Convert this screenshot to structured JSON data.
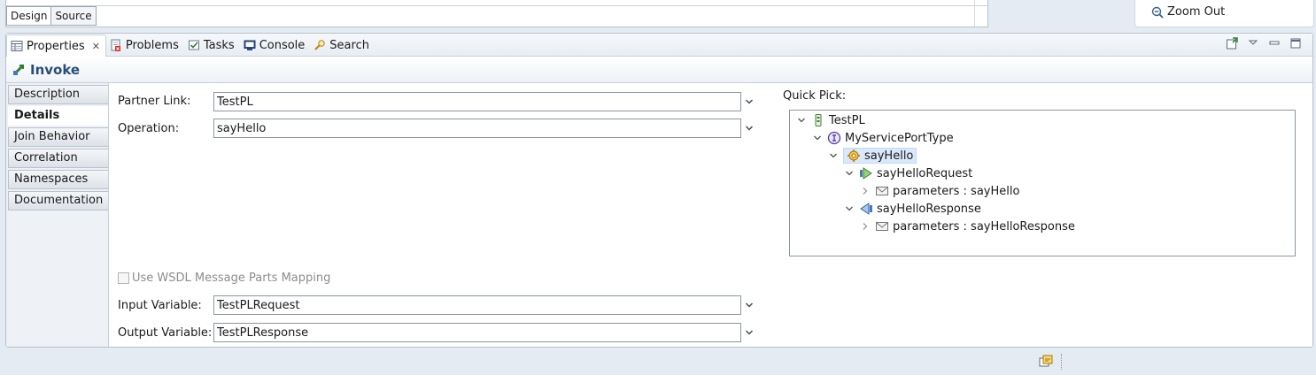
{
  "editor": {
    "tabs": [
      {
        "label": "Design",
        "active": true
      },
      {
        "label": "Source",
        "active": false
      }
    ]
  },
  "palette": {
    "zoom_out_label": "Zoom Out"
  },
  "views": {
    "tabs": [
      {
        "label": "Properties",
        "icon": "properties-icon",
        "active": true
      },
      {
        "label": "Problems",
        "icon": "problems-icon"
      },
      {
        "label": "Tasks",
        "icon": "tasks-icon"
      },
      {
        "label": "Console",
        "icon": "console-icon"
      },
      {
        "label": "Search",
        "icon": "search-icon"
      }
    ]
  },
  "properties": {
    "title": "Invoke",
    "side_tabs": [
      {
        "label": "Description",
        "active": false
      },
      {
        "label": "Details",
        "active": true
      },
      {
        "label": "Join Behavior",
        "active": false
      },
      {
        "label": "Correlation",
        "active": false
      },
      {
        "label": "Namespaces",
        "active": false
      },
      {
        "label": "Documentation",
        "active": false
      }
    ],
    "partner_link": {
      "label": "Partner Link:",
      "value": "TestPL"
    },
    "operation": {
      "label": "Operation:",
      "value": "sayHello"
    },
    "wsdl_mapping": {
      "label": "Use WSDL Message Parts Mapping",
      "checked": false,
      "enabled": false
    },
    "input_variable": {
      "label": "Input Variable:",
      "value": "TestPLRequest"
    },
    "output_variable": {
      "label": "Output Variable:",
      "value": "TestPLResponse"
    },
    "quick_pick": {
      "label": "Quick Pick:",
      "tree": [
        {
          "label": "TestPL",
          "icon": "partner-link-icon",
          "expanded": true
        },
        {
          "label": "MyServicePortType",
          "icon": "interface-icon",
          "expanded": true
        },
        {
          "label": "sayHello",
          "icon": "operation-icon",
          "expanded": true,
          "selected": true
        },
        {
          "label": "sayHelloRequest",
          "icon": "input-message-icon",
          "expanded": true
        },
        {
          "label": "parameters : sayHello",
          "icon": "message-part-icon",
          "expanded": false
        },
        {
          "label": "sayHelloResponse",
          "icon": "output-message-icon",
          "expanded": true
        },
        {
          "label": "parameters : sayHelloResponse",
          "icon": "message-part-icon",
          "expanded": false
        }
      ]
    }
  },
  "colors": {
    "title_text": "#2a4d78",
    "background": "#e4ebf3",
    "selection": "#d9e8fb"
  }
}
